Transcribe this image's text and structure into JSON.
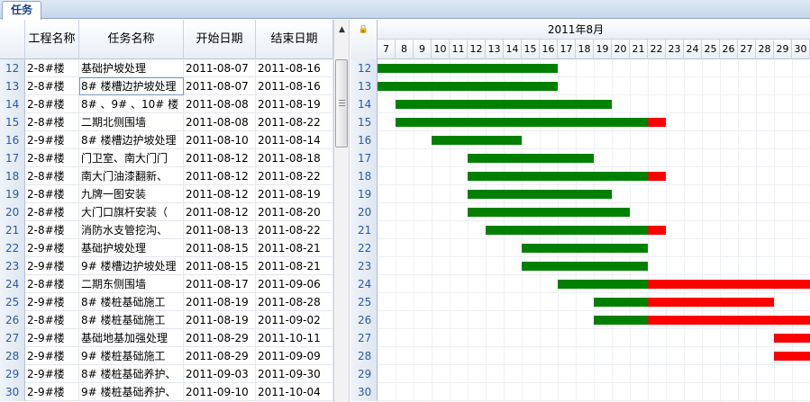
{
  "tab": {
    "label": "任务"
  },
  "grid": {
    "headers": [
      "工程名称",
      "任务名称",
      "开始日期",
      "结束日期"
    ],
    "rows": [
      {
        "num": "12",
        "project": "2-8#楼",
        "task": "基础护坡处理",
        "start": "2011-08-07",
        "end": "2011-08-16"
      },
      {
        "num": "13",
        "project": "2-8#楼",
        "task": "8# 楼槽边护坡处理",
        "start": "2011-08-07",
        "end": "2011-08-16"
      },
      {
        "num": "14",
        "project": "2-8#楼",
        "task": "8# 、9# 、10# 楼",
        "start": "2011-08-08",
        "end": "2011-08-19"
      },
      {
        "num": "15",
        "project": "2-8#楼",
        "task": "二期北侧围墙",
        "start": "2011-08-08",
        "end": "2011-08-22"
      },
      {
        "num": "16",
        "project": "2-9#楼",
        "task": "8# 楼槽边护坡处理",
        "start": "2011-08-10",
        "end": "2011-08-14"
      },
      {
        "num": "17",
        "project": "2-8#楼",
        "task": "门卫室、南大门门",
        "start": "2011-08-12",
        "end": "2011-08-18"
      },
      {
        "num": "18",
        "project": "2-8#楼",
        "task": "南大门油漆翻新、",
        "start": "2011-08-12",
        "end": "2011-08-22"
      },
      {
        "num": "19",
        "project": "2-8#楼",
        "task": "九牌一图安装",
        "start": "2011-08-12",
        "end": "2011-08-19"
      },
      {
        "num": "20",
        "project": "2-8#楼",
        "task": "大门口旗杆安装（",
        "start": "2011-08-12",
        "end": "2011-08-20"
      },
      {
        "num": "21",
        "project": "2-8#楼",
        "task": "消防水支管挖沟、",
        "start": "2011-08-13",
        "end": "2011-08-22"
      },
      {
        "num": "22",
        "project": "2-9#楼",
        "task": "基础护坡处理",
        "start": "2011-08-15",
        "end": "2011-08-21"
      },
      {
        "num": "23",
        "project": "2-9#楼",
        "task": "9# 楼槽边护坡处理",
        "start": "2011-08-15",
        "end": "2011-08-21"
      },
      {
        "num": "24",
        "project": "2-8#楼",
        "task": "二期东侧围墙",
        "start": "2011-08-17",
        "end": "2011-09-06"
      },
      {
        "num": "25",
        "project": "2-9#楼",
        "task": "8# 楼桩基础施工",
        "start": "2011-08-19",
        "end": "2011-08-28"
      },
      {
        "num": "26",
        "project": "2-8#楼",
        "task": "8# 楼桩基础施工",
        "start": "2011-08-19",
        "end": "2011-09-02"
      },
      {
        "num": "27",
        "project": "2-9#楼",
        "task": "基础地基加强处理",
        "start": "2011-08-29",
        "end": "2011-10-11"
      },
      {
        "num": "28",
        "project": "2-9#楼",
        "task": "9# 楼桩基础施工",
        "start": "2011-08-29",
        "end": "2011-09-09"
      },
      {
        "num": "29",
        "project": "2-9#楼",
        "task": "8# 楼桩基础养护、",
        "start": "2011-09-03",
        "end": "2011-09-30"
      },
      {
        "num": "30",
        "project": "2-9#楼",
        "task": "9# 楼桩基础养护、",
        "start": "2011-09-10",
        "end": "2011-10-04"
      }
    ]
  },
  "gantt": {
    "month_label": "2011年8月",
    "days": [
      "7",
      "8",
      "9",
      "10",
      "11",
      "12",
      "13",
      "14",
      "15",
      "16",
      "17",
      "18",
      "19",
      "20",
      "21",
      "22",
      "23",
      "24",
      "25",
      "26",
      "27",
      "28",
      "29",
      "30"
    ],
    "status_date": "2011-08-22",
    "colors": {
      "plan": "#008000",
      "late": "#ff0000"
    }
  }
}
